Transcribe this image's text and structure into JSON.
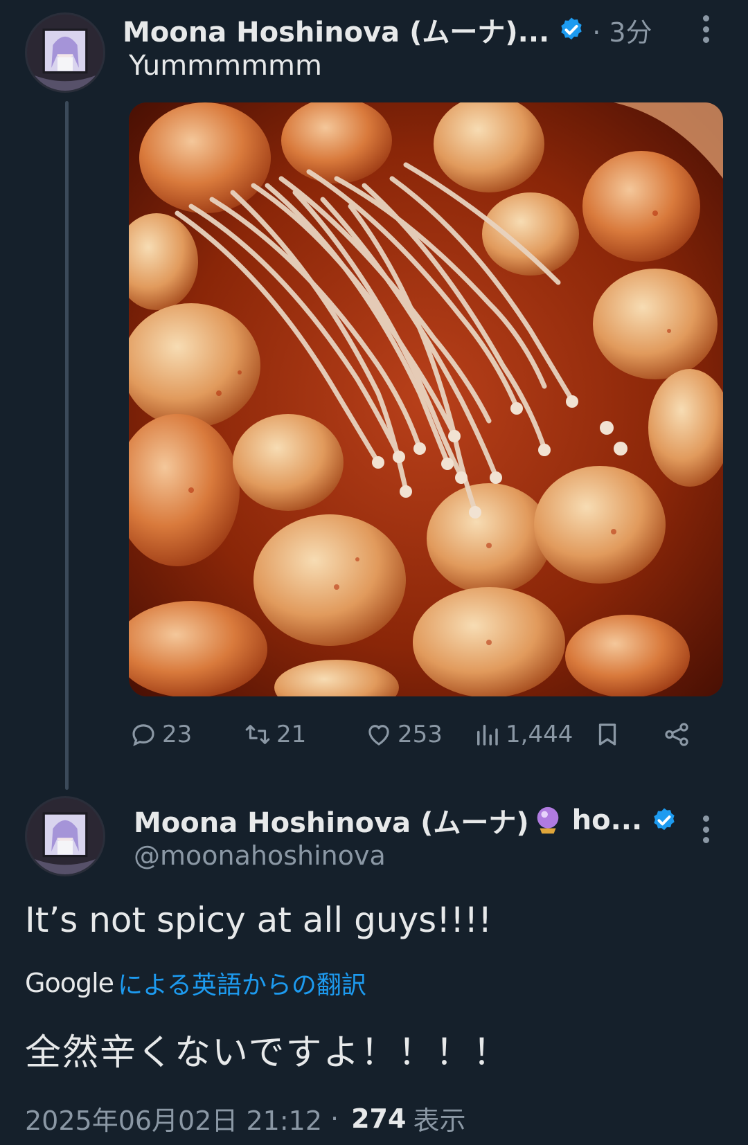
{
  "colors": {
    "background": "#15202b",
    "primary_text": "#e7e9ea",
    "secondary_text": "#8b98a5",
    "link": "#1d9bf0",
    "verified": "#1d9bf0"
  },
  "tweets": [
    {
      "display_name": "Moona Hoshinova (ムーナ)...",
      "verified": true,
      "time": "· 3分",
      "text": "Yummmmmm",
      "media_alt": "photo-spicy-hotpot-enoki-fishballs",
      "actions": {
        "replies": "23",
        "retweets": "21",
        "likes": "253",
        "views": "1,444"
      }
    },
    {
      "display_name": "Moona Hoshinova (ムーナ)",
      "display_name_emoji": "crystal-ball-icon",
      "display_name_suffix": "ho...",
      "verified": true,
      "handle": "@moonahoshinova",
      "text": "It’s not spicy at all guys!!!!",
      "translation_provider": "Google",
      "translation_label": "による英語からの翻訳",
      "translated_text": "全然辛くないですよ！！！！",
      "timestamp": "2025年06月02日 21:12",
      "separator": "·",
      "views_count": "274",
      "views_label": "表示"
    }
  ]
}
